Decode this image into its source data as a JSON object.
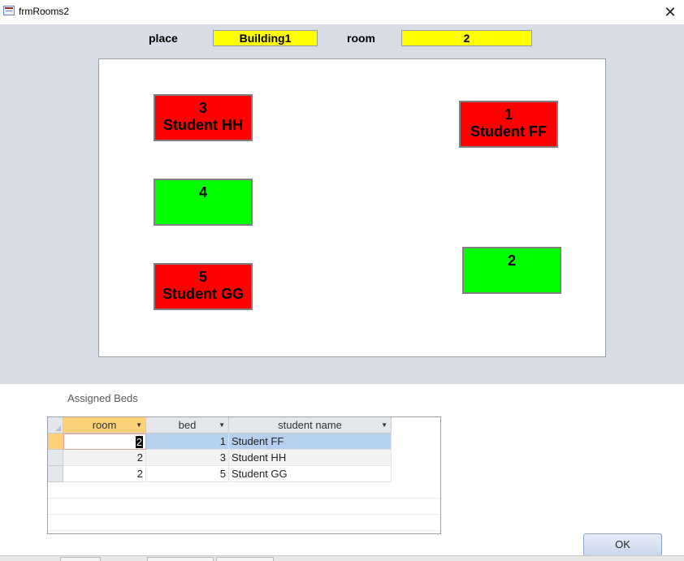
{
  "window": {
    "title": "frmRooms2",
    "close_symbol": "✕"
  },
  "header": {
    "place_label": "place",
    "place_value": "Building1",
    "room_label": "room",
    "room_value": "2"
  },
  "beds": [
    {
      "number": "3",
      "student": "Student HH",
      "status": "occupied"
    },
    {
      "number": "1",
      "student": "Student FF",
      "status": "occupied"
    },
    {
      "number": "4",
      "student": "",
      "status": "free"
    },
    {
      "number": "2",
      "student": "",
      "status": "free"
    },
    {
      "number": "5",
      "student": "Student GG",
      "status": "occupied"
    }
  ],
  "colors": {
    "occupied": "#ff0000",
    "free": "#00ff00",
    "field": "#ffff00",
    "header_bg": "#d8dde5"
  },
  "subform": {
    "label": "Assigned Beds",
    "columns": [
      "room",
      "bed",
      "student name"
    ],
    "rows": [
      {
        "room": "2",
        "bed": "1",
        "student_name": "Student FF"
      },
      {
        "room": "2",
        "bed": "3",
        "student_name": "Student HH"
      },
      {
        "room": "2",
        "bed": "5",
        "student_name": "Student GG"
      }
    ]
  },
  "buttons": {
    "ok": "OK"
  },
  "icons": {
    "window": "form-icon",
    "close": "close-icon",
    "sort": "dropdown-arrow-icon"
  }
}
